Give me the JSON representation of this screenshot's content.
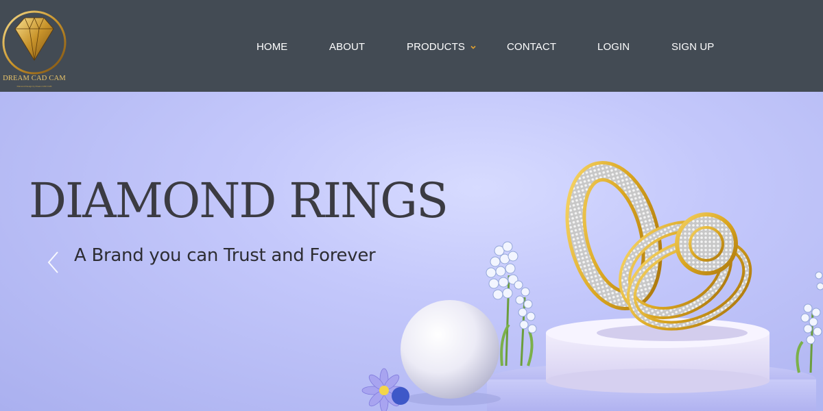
{
  "brand": {
    "name": "DREAM CAD CAM",
    "tagline": "Diamond Design by Dream CAD CAM"
  },
  "nav": {
    "items": [
      {
        "label": "HOME"
      },
      {
        "label": "ABOUT"
      },
      {
        "label": "PRODUCTS",
        "has_dropdown": true
      },
      {
        "label": "CONTACT"
      },
      {
        "label": "LOGIN"
      },
      {
        "label": "SIGN UP"
      }
    ]
  },
  "hero": {
    "title": "DIAMOND RINGS",
    "subtitle": "A Brand you can Trust and Forever",
    "prev_icon": "chevron-left-icon"
  },
  "colors": {
    "header_bg": "#434b54",
    "hero_bg": "#c4c8fb",
    "gold": "#d9a520",
    "nav_text": "#ffffff",
    "caret": "#e0a030"
  }
}
